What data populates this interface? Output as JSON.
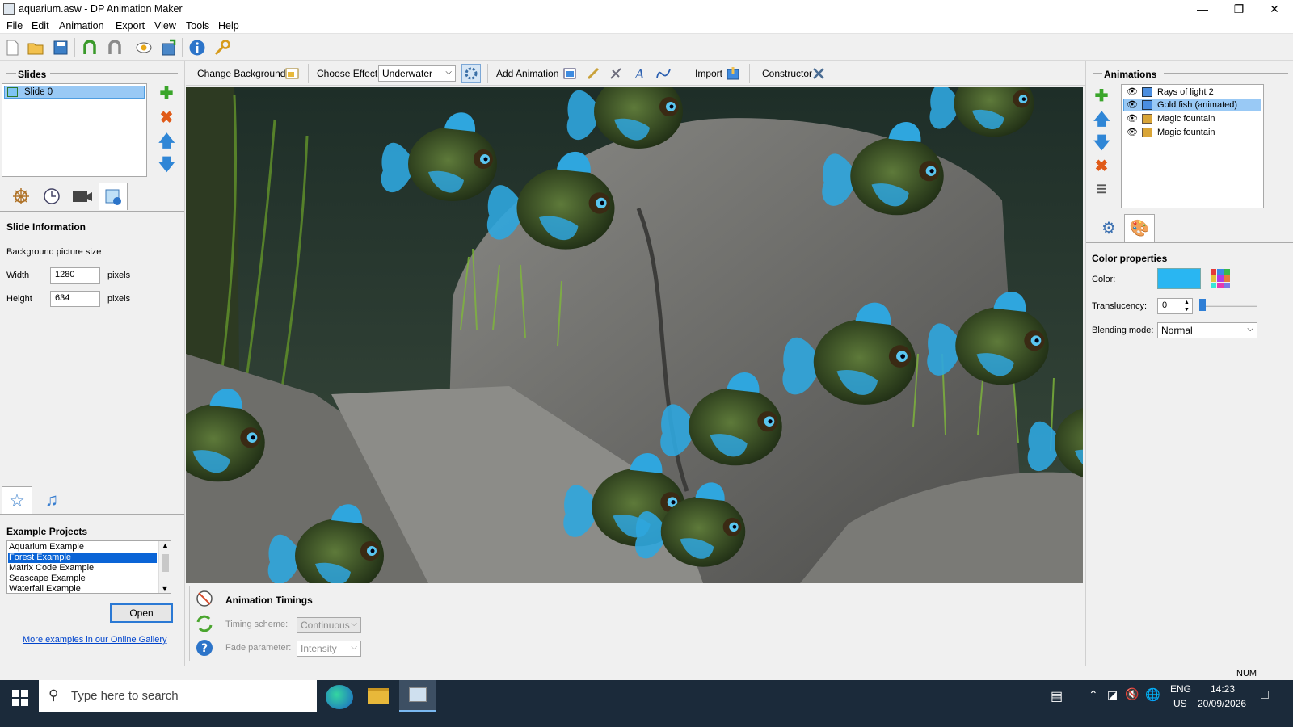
{
  "window": {
    "title": "aquarium.asw - DP Animation Maker"
  },
  "menu": [
    "File",
    "Edit",
    "Animation",
    "Export",
    "View",
    "Tools",
    "Help"
  ],
  "toolbar_icons": [
    "new-file-icon",
    "open-folder-icon",
    "save-icon",
    "undo-icon",
    "redo-icon",
    "preview-eye-icon",
    "export-icon",
    "info-icon",
    "key-icon"
  ],
  "slides": {
    "header": "Slides",
    "items": [
      "Slide 0"
    ],
    "tabs": [
      "helm-icon",
      "clock-icon",
      "camera-icon",
      "slide-info-icon"
    ]
  },
  "slide_info": {
    "title": "Slide Information",
    "subtitle": "Background picture size",
    "width_label": "Width",
    "width_value": "1280",
    "height_label": "Height",
    "height_value": "634",
    "unit": "pixels"
  },
  "examples": {
    "header": "Example Projects",
    "items": [
      "Aquarium Example",
      "Forest Example",
      "Matrix Code Example",
      "Seascape Example",
      "Waterfall Example"
    ],
    "selected_index": 1,
    "open_label": "Open",
    "gallery_link": "More examples in our Online Gallery"
  },
  "effectbar": {
    "change_background": "Change Background",
    "choose_effect_label": "Choose Effect:",
    "effect_value": "Underwater",
    "add_animation": "Add Animation",
    "import": "Import",
    "constructor": "Constructor"
  },
  "timings": {
    "title": "Animation Timings",
    "scheme_label": "Timing scheme:",
    "scheme_value": "Continuous",
    "fade_label": "Fade parameter:",
    "fade_value": "Intensity"
  },
  "animations": {
    "header": "Animations",
    "items": [
      "Rays of light 2",
      "Gold fish (animated)",
      "Magic fountain",
      "Magic fountain"
    ],
    "selected_index": 1
  },
  "color_props": {
    "title": "Color properties",
    "color_label": "Color:",
    "color_value": "#29b6f2",
    "translucency_label": "Translucency:",
    "translucency_value": "0",
    "blending_label": "Blending mode:",
    "blending_value": "Normal"
  },
  "status": {
    "num": "NUM"
  },
  "taskbar": {
    "search_placeholder": "Type here to search",
    "lang1": "ENG",
    "lang2": "US",
    "time": "14:23",
    "date": "20/09/2026"
  }
}
